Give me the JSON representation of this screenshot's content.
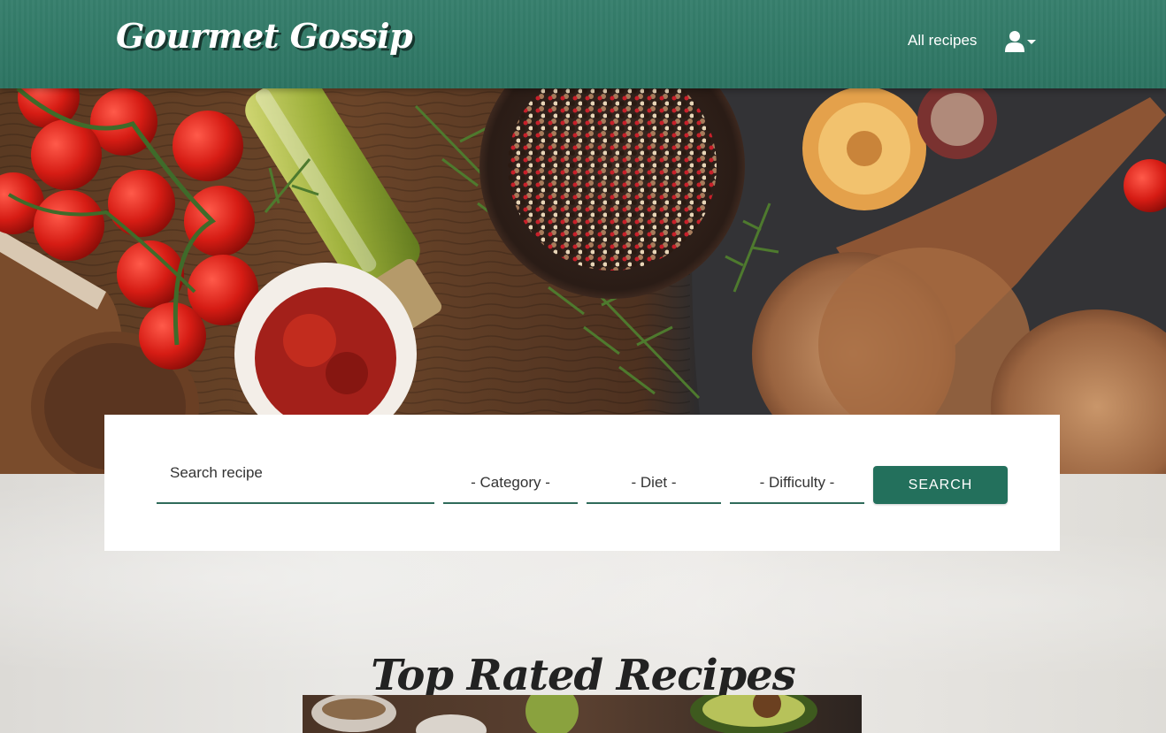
{
  "navbar": {
    "brand": "Gourmet Gossip",
    "links": [
      {
        "label": "All recipes"
      }
    ],
    "user_icon": "user-icon",
    "dropdown_icon": "caret-down-icon"
  },
  "search": {
    "placeholder": "Search recipe",
    "category": "- Category -",
    "diet": "- Diet -",
    "difficulty": "- Difficulty -",
    "button_label": "SEARCH"
  },
  "section": {
    "title": "Top Rated Recipes"
  },
  "colors": {
    "brand_green": "#2f7a67",
    "button_green": "#23705c",
    "underline_green": "#2f6b5a"
  }
}
